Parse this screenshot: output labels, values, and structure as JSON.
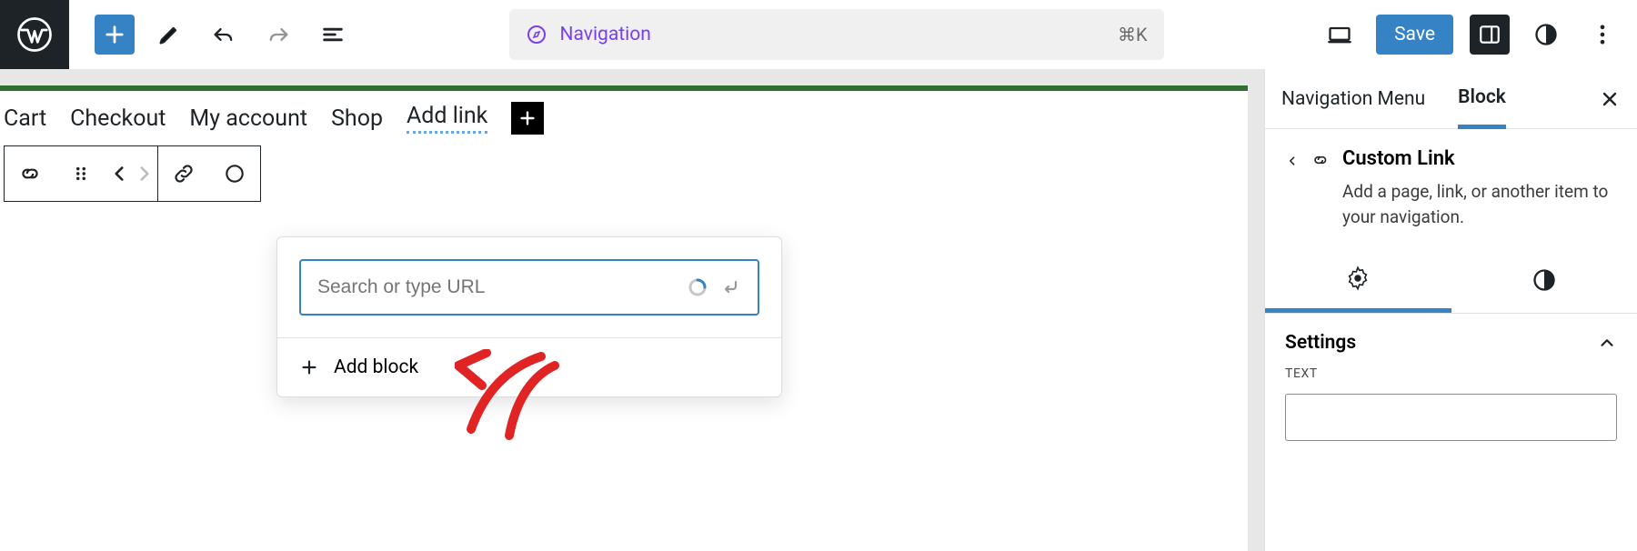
{
  "topbar": {
    "nav_label": "Navigation",
    "shortcut": "⌘K",
    "save_label": "Save"
  },
  "canvas": {
    "nav_items": [
      "Cart",
      "Checkout",
      "My account",
      "Shop"
    ],
    "add_link_label": "Add link"
  },
  "popover": {
    "placeholder": "Search or type URL",
    "add_block_label": "Add block"
  },
  "sidebar": {
    "tabs": {
      "menu": "Navigation Menu",
      "block": "Block"
    },
    "block": {
      "title": "Custom Link",
      "description": "Add a page, link, or another item to your navigation."
    },
    "settings_label": "Settings",
    "text_field_label": "TEXT",
    "text_field_value": ""
  }
}
